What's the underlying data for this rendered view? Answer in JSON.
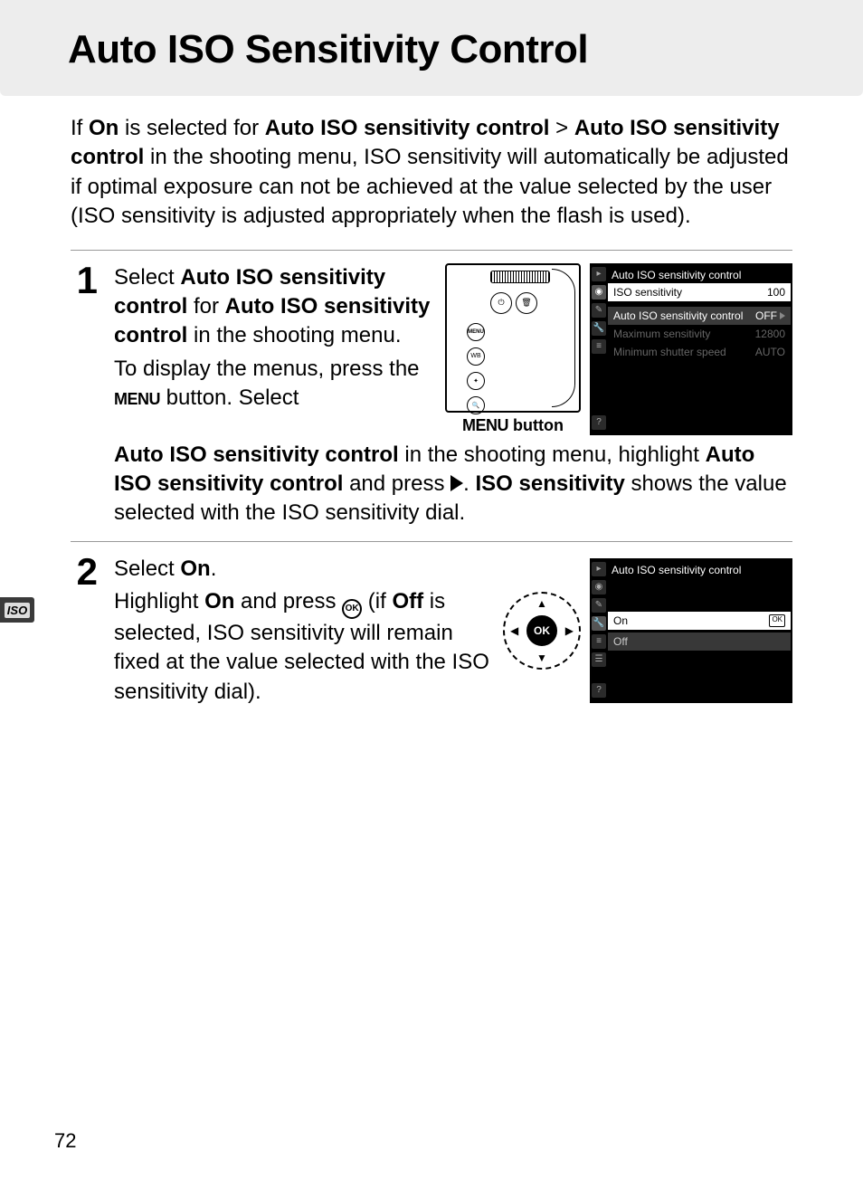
{
  "title": "Auto ISO Sensitivity Control",
  "intro": {
    "t1": "If ",
    "b1": "On",
    "t2": " is selected for ",
    "b2": "Auto ISO sensitivity control",
    "t3": " > ",
    "b3": "Auto ISO sensitivity control",
    "t4": " in the shooting menu, ISO sensitivity will automatically be adjusted if optimal exposure can not be achieved at the value selected by the user (ISO sensitivity is adjusted appropriately when the flash is used)."
  },
  "step1": {
    "num": "1",
    "h1a": "Select ",
    "h1b": "Auto ISO sensitivity control",
    "h1c": " for ",
    "h1d": "Auto ISO sensitivity control",
    "h1e": " in the shooting menu.",
    "p1a": "To display the menus, press the ",
    "menu": "MENU",
    "p1b": " button.  Select ",
    "c1a": "Auto ISO sensitivity control",
    "c1b": " in the shooting menu, highlight ",
    "c1c": "Auto ISO sensitivity control",
    "c1d": " and press ",
    "c1e": ". ",
    "c1f": "ISO sensitivity",
    "c1g": " shows the value selected with the ISO sensitivity dial.",
    "caption_a": "MENU",
    "caption_b": " button"
  },
  "lcd1": {
    "title": "Auto ISO sensitivity control",
    "row1_label": "ISO sensitivity",
    "row1_val": "100",
    "row2_label": "Auto ISO sensitivity control",
    "row2_val": "OFF",
    "row3_label": "Maximum sensitivity",
    "row3_val": "12800",
    "row4_label": "Minimum shutter speed",
    "row4_val": "AUTO"
  },
  "step2": {
    "num": "2",
    "h": "Select ",
    "hb": "On",
    "hd": ".",
    "p1": "Highlight ",
    "b1": "On",
    "p2": " and press ",
    "p3": " (if ",
    "b2": "Off",
    "p4": " is selected, ISO sensitivity will remain fixed at the value selected with the ISO sensitivity dial)."
  },
  "lcd2": {
    "title": "Auto ISO sensitivity control",
    "on": "On",
    "off": "Off",
    "ok": "OK"
  },
  "selector_ok": "OK",
  "side_tab": "ISO",
  "page_number": "72"
}
